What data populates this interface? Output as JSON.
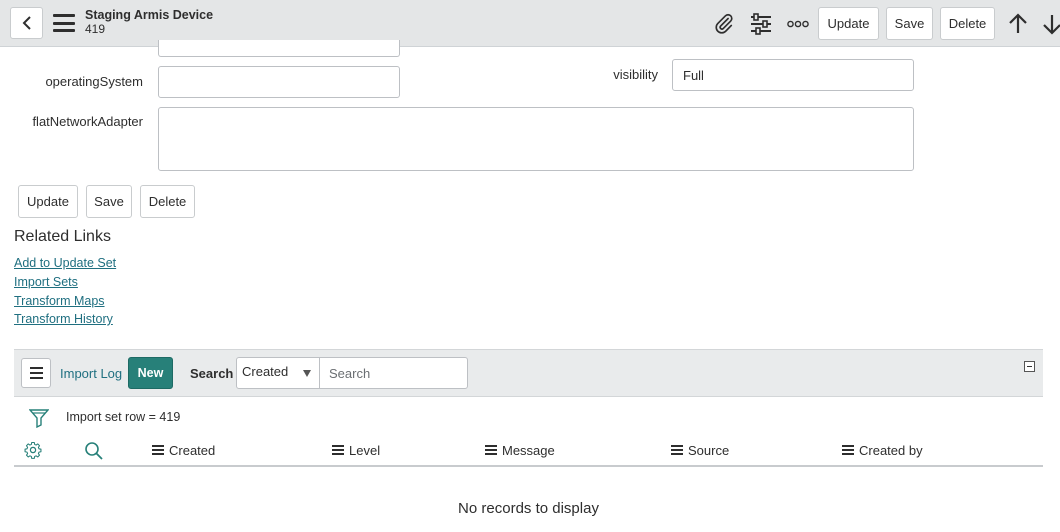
{
  "header": {
    "title": "Staging Armis Device",
    "subtitle": "419",
    "buttons": {
      "update": "Update",
      "save": "Save",
      "delete": "Delete"
    },
    "icons": [
      "paperclip-icon",
      "sliders-icon",
      "more-options-icon",
      "arrow-up-icon",
      "arrow-down-icon"
    ]
  },
  "form": {
    "fields": {
      "operating_system": {
        "label": "operatingSystem",
        "value": ""
      },
      "visibility": {
        "label": "visibility",
        "value": "Full"
      },
      "flat_network_adapter": {
        "label": "flatNetworkAdapter",
        "value": ""
      }
    },
    "buttons": {
      "update": "Update",
      "save": "Save",
      "delete": "Delete"
    }
  },
  "related_links": {
    "title": "Related Links",
    "links": [
      "Add to Update Set",
      "Import Sets",
      "Transform Maps",
      "Transform History"
    ]
  },
  "related_list": {
    "name": "Import Log",
    "new_label": "New",
    "search_label": "Search",
    "search_field": "Created",
    "search_placeholder": "Search",
    "filter": "Import set row = 419",
    "columns": [
      "Created",
      "Level",
      "Message",
      "Source",
      "Created by"
    ],
    "empty_message": "No records to display"
  },
  "colors": {
    "accent": "#278079",
    "link": "#1f6f80",
    "header_bg": "#e4e6e7"
  }
}
